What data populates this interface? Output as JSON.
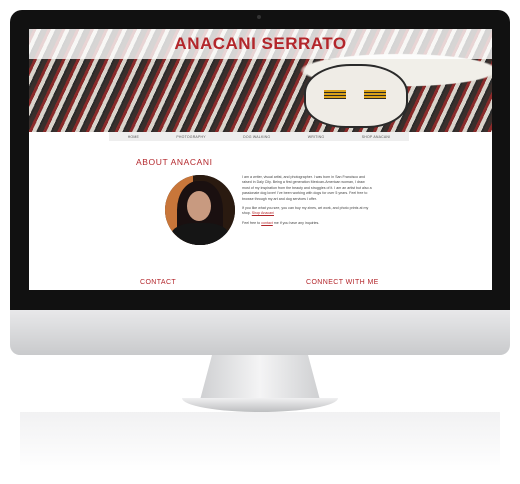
{
  "site": {
    "title": "ANACANI SERRATO"
  },
  "nav": {
    "items": [
      "HOME",
      "PHOTOGRAPHY",
      "DOG WALKING",
      "WRITING",
      "SHOP ANACANI"
    ]
  },
  "about": {
    "heading": "ABOUT ANACANI",
    "p1": "I am a writer, visual artist, and photographer. I was born in San Francisco and raised in Daly City. Being a first generation Mexican-American woman, I draw most of my inspiration from the beauty and struggles of it. I am an artist but also a passionate dog lover! I've been working with dogs for over 5 years. Feel free to browse through my art and dog services I offer.",
    "p2_before": "If you like what you see, you can buy my zines, art work, and photo prints at my shop. ",
    "p2_link": "Shop Anacani",
    "p3_before": "Feel free to ",
    "p3_link": "contact",
    "p3_after": " me if you have any inquiries."
  },
  "footer": {
    "contact": "CONTACT",
    "connect": "CONNECT WITH ME"
  }
}
